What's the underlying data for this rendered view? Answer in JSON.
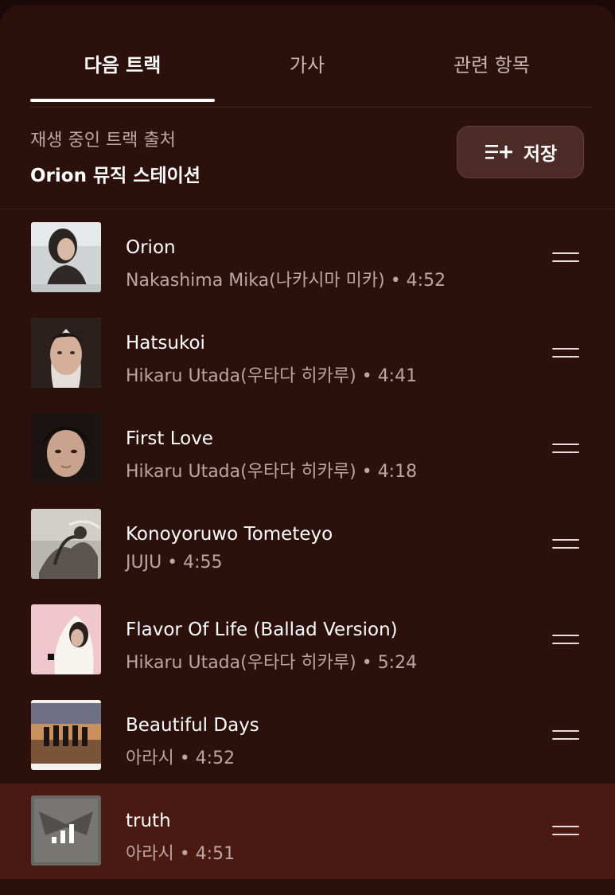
{
  "tabs": [
    {
      "label": "다음 트랙",
      "active": true
    },
    {
      "label": "가사",
      "active": false
    },
    {
      "label": "관련 항목",
      "active": false
    }
  ],
  "source": {
    "label": "재생 중인 트랙 출처",
    "name": "Orion 뮤직 스테이션"
  },
  "save_button": {
    "icon": "playlist-add-icon",
    "label": "저장"
  },
  "tracks": [
    {
      "title": "Orion",
      "subtitle": "Nakashima Mika(나카시마 미카) • 4:52"
    },
    {
      "title": "Hatsukoi",
      "subtitle": "Hikaru Utada(우타다 히카루) • 4:41"
    },
    {
      "title": "First Love",
      "subtitle": "Hikaru Utada(우타다 히카루) • 4:18"
    },
    {
      "title": "Konoyoruwo Tometeyo",
      "subtitle": "JUJU • 4:55"
    },
    {
      "title": "Flavor Of Life (Ballad Version)",
      "subtitle": "Hikaru Utada(우타다 히카루) • 5:24"
    },
    {
      "title": "Beautiful Days",
      "subtitle": "아라시 • 4:52"
    },
    {
      "title": "truth",
      "subtitle": "아라시 • 4:51",
      "playing": true
    }
  ],
  "colors": {
    "background": "#2c100c",
    "now_playing_row": "#4a1911",
    "primary_text": "#ffffff",
    "secondary_text": "#bca6a2"
  }
}
